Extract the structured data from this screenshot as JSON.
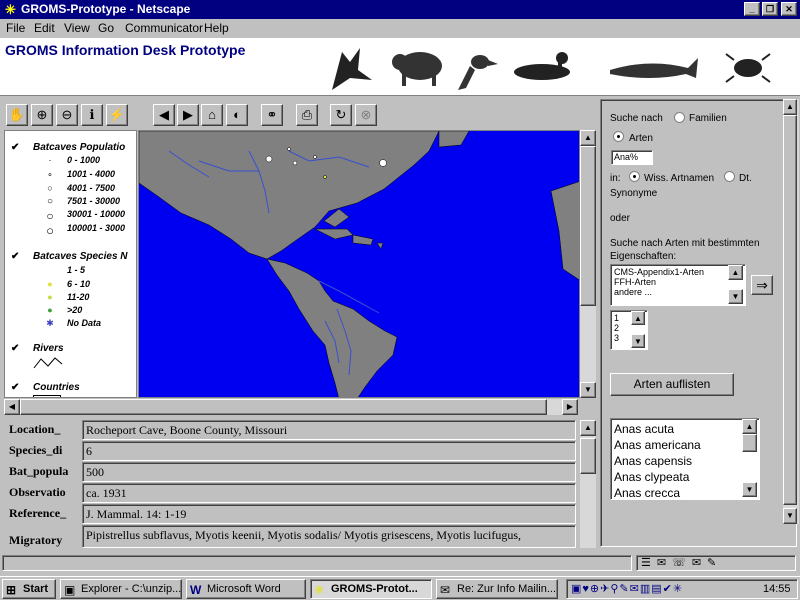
{
  "window": {
    "title": "GROMS-Prototype - Netscape"
  },
  "menu": [
    "File",
    "Edit",
    "View",
    "Go",
    "Communicator",
    "Help"
  ],
  "banner": {
    "heading": "GROMS Information Desk Prototype"
  },
  "toolbar": {
    "tools": [
      "hand-icon",
      "zoom-in-icon",
      "zoom-out-icon",
      "info-icon",
      "hotlink-icon",
      "back-arrow-icon",
      "forward-arrow-icon",
      "home-icon",
      "globe-icon",
      "binoculars-icon",
      "print-icon",
      "refresh-icon",
      "stop-icon"
    ]
  },
  "legend": {
    "layers": [
      {
        "name": "Batcaves Populatio",
        "classes": [
          "0 - 1000",
          "1001 - 4000",
          "4001 - 7500",
          "7501 - 30000",
          "30001 - 10000",
          "100001 - 3000"
        ]
      },
      {
        "name": "Batcaves Species N",
        "classes": [
          "1 - 5",
          "6 - 10",
          "11-20",
          ">20",
          "No Data"
        ]
      },
      {
        "name": "Rivers",
        "classes": []
      },
      {
        "name": "Countries",
        "classes": []
      }
    ]
  },
  "attributes": [
    {
      "key": "Location_",
      "value": "Rocheport Cave, Boone County, Missouri"
    },
    {
      "key": "Species_di",
      "value": "6"
    },
    {
      "key": "Bat_popula",
      "value": "500"
    },
    {
      "key": "Observatio",
      "value": "ca. 1931"
    },
    {
      "key": "Reference_",
      "value": "J. Mammal. 14: 1-19"
    },
    {
      "key": "Migratory",
      "value": "Pipistrellus subflavus, Myotis keenii, Myotis sodalis/ Myotis grisescens, Myotis lucifugus,"
    }
  ],
  "search": {
    "suche_nach": "Suche nach",
    "familien": "Familien",
    "arten": "Arten",
    "query_value": "Ana%",
    "in_label": "in:",
    "wiss_label": "Wiss. Artnamen",
    "dt_label": "Dt.",
    "synonyme": "Synonyme",
    "oder": "oder",
    "eigen_line1": "Suche nach Arten mit bestimmten",
    "eigen_line2": "Eigenschaften:",
    "properties": [
      "CMS-Appendix1-Arten",
      "FFH-Arten",
      "andere ..."
    ],
    "numbers": [
      "1",
      "2",
      "3"
    ],
    "list_button": "Arten auflisten",
    "results": [
      "Anas acuta",
      "Anas americana",
      "Anas capensis",
      "Anas clypeata",
      "Anas crecca"
    ]
  },
  "taskbar": {
    "start": "Start",
    "tasks": [
      "Explorer - C:\\unzip...",
      "Microsoft Word",
      "GROMS-Protot...",
      "Re: Zur Info Mailin..."
    ],
    "clock": "14:55"
  },
  "colors": {
    "titlebar": "#000080",
    "ocean": "#0000f0",
    "land": "#808080",
    "rivers": "#3a4fd0",
    "accent_yellow": "#e0e040",
    "accent_green": "#40a040"
  }
}
